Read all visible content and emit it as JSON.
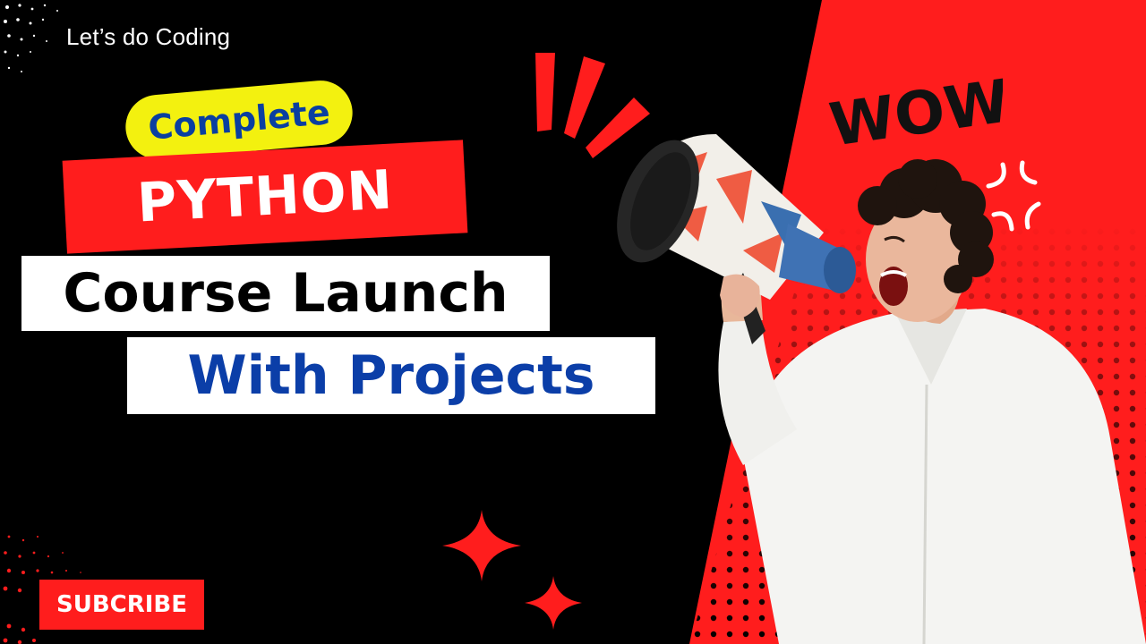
{
  "brand": {
    "text": "Let’s do Coding"
  },
  "headline": {
    "pill": "Complete",
    "topic": "PYTHON",
    "line1": "Course Launch",
    "line2": "With Projects"
  },
  "subscribe_button": {
    "label": "SUBCRIBE"
  },
  "sticker": {
    "text": "WOW"
  },
  "colors": {
    "background": "#000000",
    "accent_red": "#ff1d1d",
    "pill_yellow": "#f3f10f",
    "text_blue": "#0b3ea8",
    "white": "#ffffff"
  },
  "icons": [
    "sparkle-icon",
    "megaphone-icon",
    "anger-burst-icon",
    "shout-lines-icon"
  ]
}
